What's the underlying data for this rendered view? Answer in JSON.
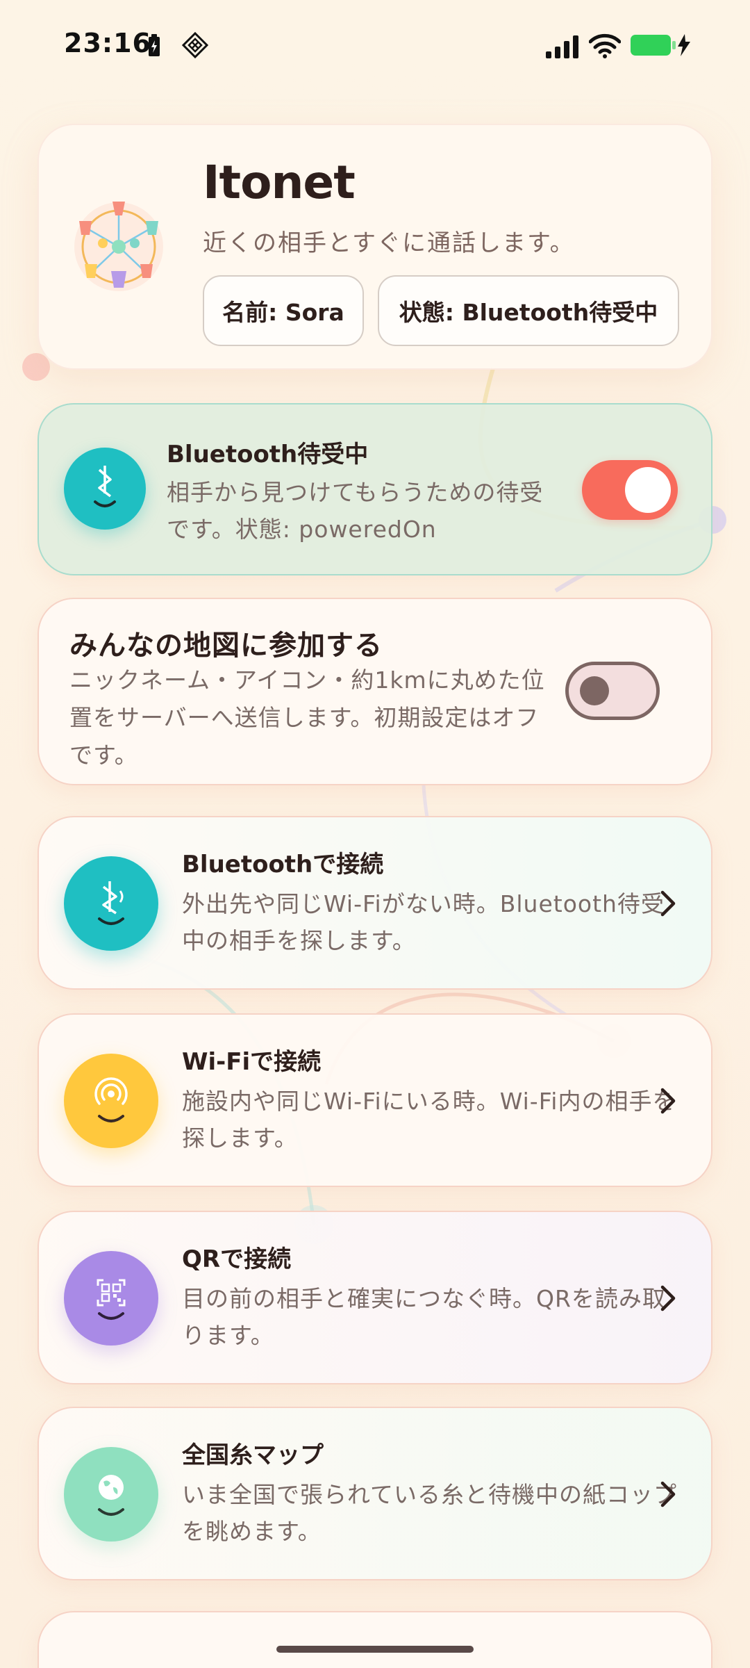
{
  "status_bar": {
    "time": "23:16",
    "battery_color": "#30d158"
  },
  "header": {
    "title": "Itonet",
    "subtitle": "近くの相手とすぐに通話します。",
    "name_pill": "名前: Sora",
    "state_pill": "状態: Bluetooth待受中"
  },
  "bluetooth_standby": {
    "title": "Bluetooth待受中",
    "description": "相手から見つけてもらうための待受です。状態: poweredOn",
    "enabled": true,
    "toggle_color": "#f86b5c",
    "icon": "bluetooth-face-icon",
    "icon_color": "#1fbfc2"
  },
  "map_join": {
    "title": "みんなの地図に参加する",
    "description": "ニックネーム・アイコン・約1kmに丸めた位置をサーバーへ送信します。初期設定はオフです。",
    "enabled": false
  },
  "nav_items": [
    {
      "title": "Bluetoothで接続",
      "description": "外出先や同じWi-Fiがない時。Bluetooth待受中の相手を探します。",
      "icon": "bluetooth-face-icon",
      "color": "#1fbfc2"
    },
    {
      "title": "Wi-Fiで接続",
      "description": "施設内や同じWi-Fiにいる時。Wi-Fi内の相手を探します。",
      "icon": "wifi-face-icon",
      "color": "#ffc83d"
    },
    {
      "title": "QRで接続",
      "description": "目の前の相手と確実につなぐ時。QRを読み取ります。",
      "icon": "qr-face-icon",
      "color": "#a98ae6"
    },
    {
      "title": "全国糸マップ",
      "description": "いま全国で張られている糸と待機中の紙コップを眺めます。",
      "icon": "globe-face-icon",
      "color": "#8fe0bf"
    }
  ]
}
